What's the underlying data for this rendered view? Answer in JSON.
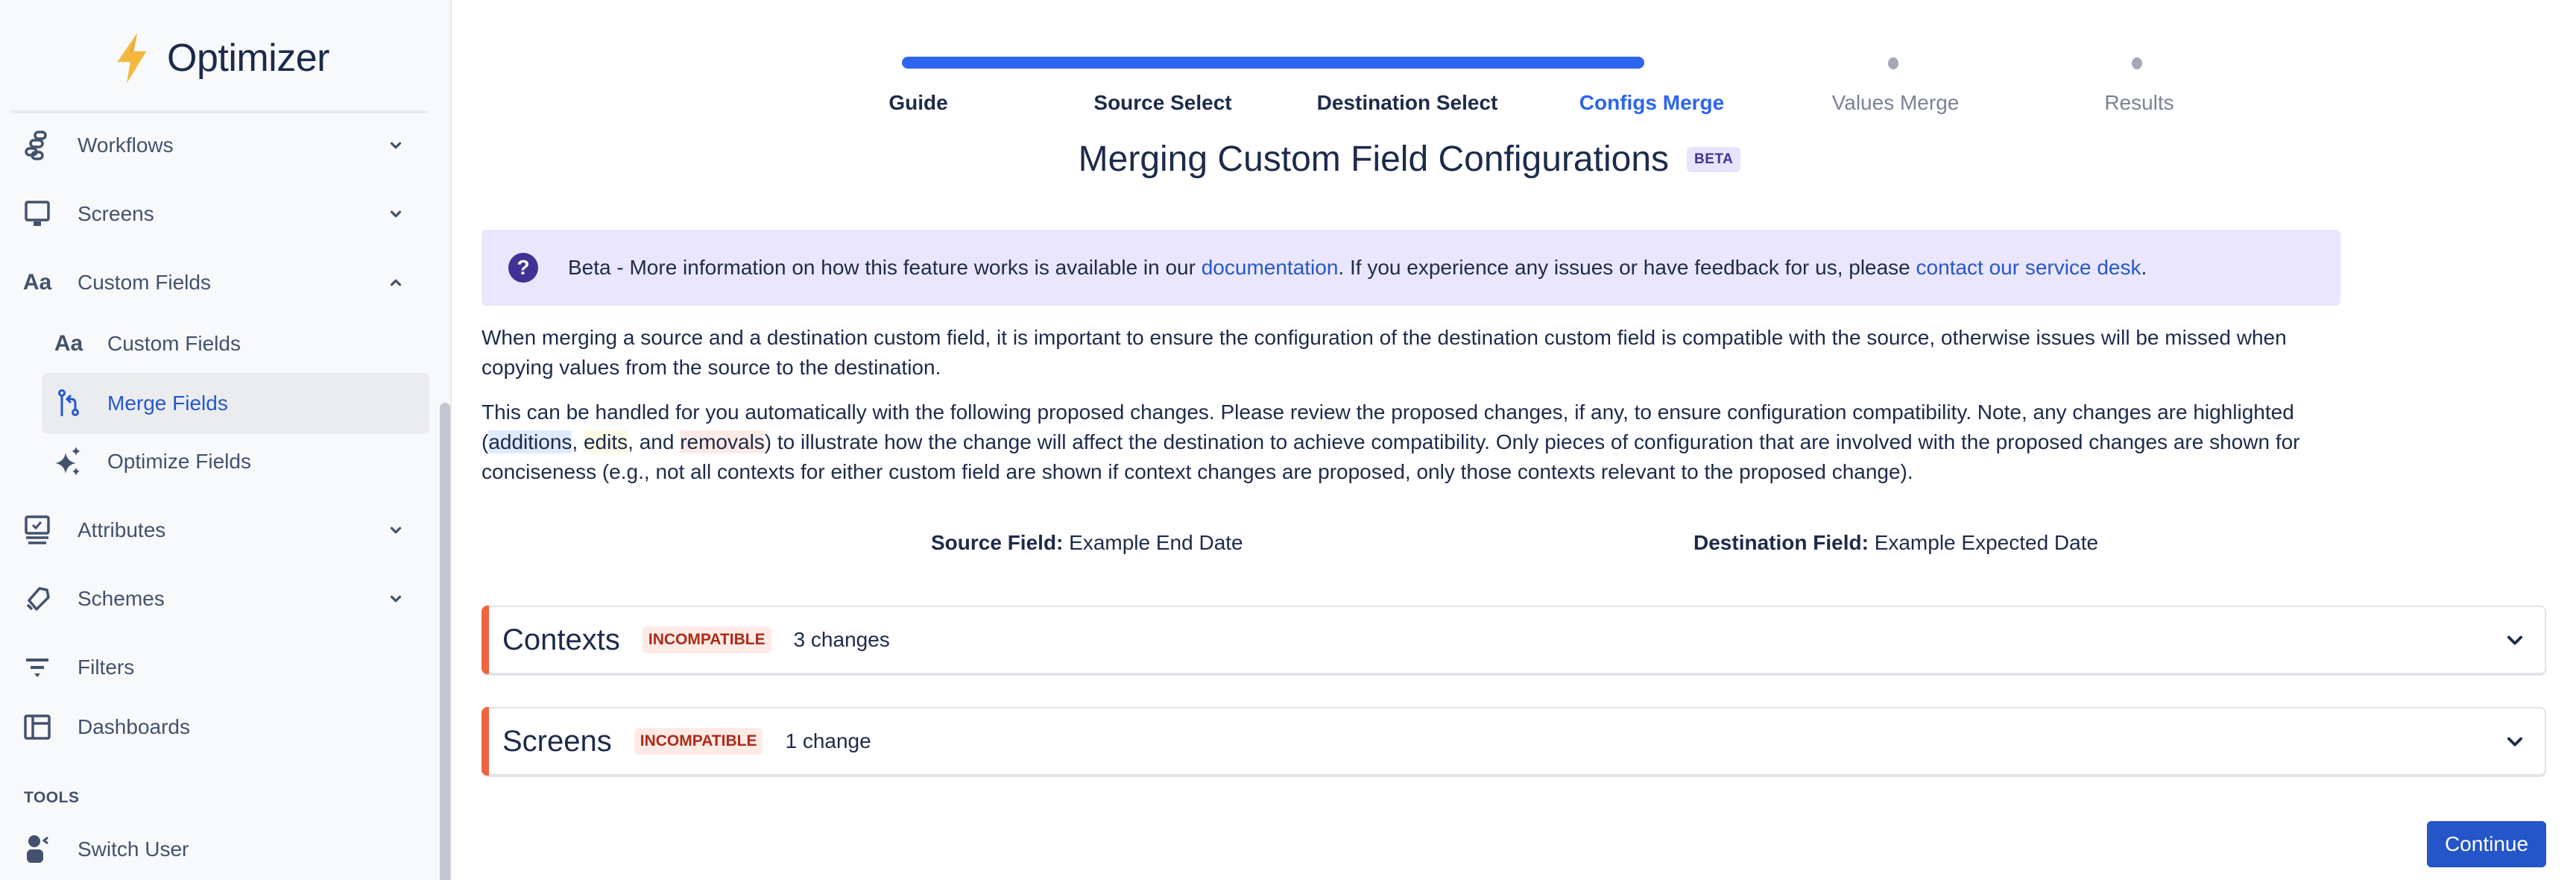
{
  "app": {
    "name": "Optimizer"
  },
  "sidebar": {
    "items": [
      {
        "label": "Workflows",
        "icon": "workflow-icon",
        "expanded": false
      },
      {
        "label": "Screens",
        "icon": "monitor-icon",
        "expanded": false
      },
      {
        "label": "Custom Fields",
        "icon": "text-aa-icon",
        "expanded": true,
        "children": [
          {
            "label": "Custom Fields",
            "icon": "text-aa-icon"
          },
          {
            "label": "Merge Fields",
            "icon": "merge-icon",
            "active": true
          },
          {
            "label": "Optimize Fields",
            "icon": "sparkles-icon"
          }
        ]
      },
      {
        "label": "Attributes",
        "icon": "attributes-icon",
        "expanded": false
      },
      {
        "label": "Schemes",
        "icon": "scheme-icon",
        "expanded": false
      },
      {
        "label": "Filters",
        "icon": "filter-icon"
      },
      {
        "label": "Dashboards",
        "icon": "dashboard-icon"
      }
    ],
    "tools_section": "TOOLS",
    "tools": [
      {
        "label": "Switch User",
        "icon": "switch-user-icon"
      }
    ]
  },
  "stepper": {
    "steps": [
      {
        "label": "Guide",
        "state": "complete"
      },
      {
        "label": "Source Select",
        "state": "complete"
      },
      {
        "label": "Destination Select",
        "state": "complete"
      },
      {
        "label": "Configs Merge",
        "state": "current"
      },
      {
        "label": "Values Merge",
        "state": "upcoming"
      },
      {
        "label": "Results",
        "state": "upcoming"
      }
    ],
    "progress_step": 4,
    "total_steps": 6
  },
  "page": {
    "title": "Merging Custom Field Configurations",
    "badge": "BETA"
  },
  "banner": {
    "text_before": "Beta - More information on how this feature works is available in our ",
    "link1": "documentation",
    "text_middle": ". If you experience any issues or have feedback for us, please ",
    "link2": "contact our service desk",
    "text_after": "."
  },
  "intro": {
    "p1": "When merging a source and a destination custom field, it is important to ensure the configuration of the destination custom field is compatible with the source, otherwise issues will be missed when copying values from the source to the destination.",
    "p2_start": "This can be handled for you automatically with the following proposed changes. Please review the proposed changes, if any, to ensure configuration compatibility. Note, any changes are highlighted (",
    "hl_additions": "additions",
    "sep1": ", ",
    "hl_edits": "edits",
    "sep2": ", and ",
    "hl_removals": "removals",
    "p2_end": ") to illustrate how the change will affect the destination to achieve compatibility. Only pieces of configuration that are involved with the proposed changes are shown for conciseness (e.g., not all contexts for either custom field are shown if context changes are proposed, only those contexts relevant to the proposed change)."
  },
  "fields": {
    "source_label": "Source Field:",
    "source_value": "Example End Date",
    "destination_label": "Destination Field:",
    "destination_value": "Example Expected Date"
  },
  "sections": [
    {
      "title": "Contexts",
      "status": "INCOMPATIBLE",
      "changes": "3 changes"
    },
    {
      "title": "Screens",
      "status": "INCOMPATIBLE",
      "changes": "1 change"
    }
  ],
  "actions": {
    "continue": "Continue"
  },
  "colors": {
    "accent": "#2d65f0",
    "primary_button": "#2455c9",
    "incompatible": "#ae2a19",
    "incompatible_bg": "#ffebe6",
    "section_stripe": "#ee6440",
    "beta_bg": "#eae6fd"
  }
}
